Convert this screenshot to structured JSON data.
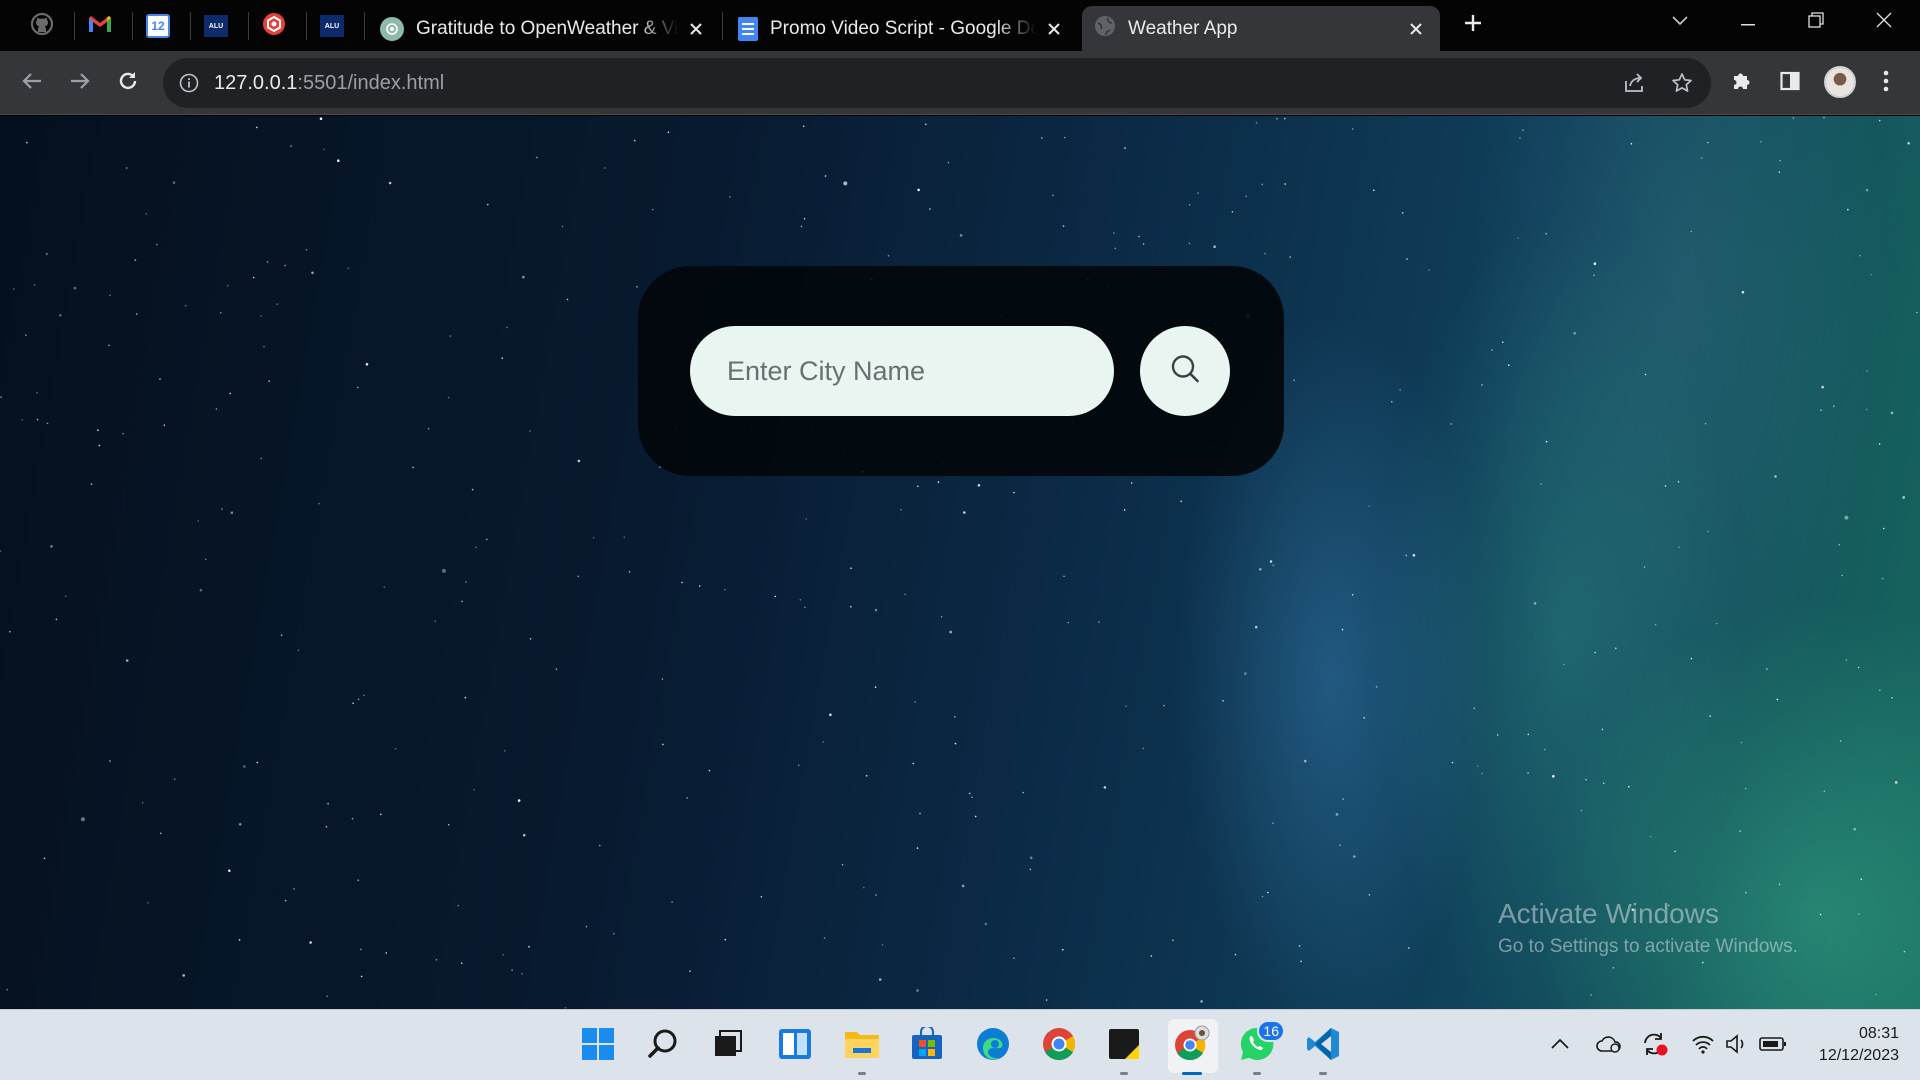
{
  "browser": {
    "tabs": [
      {
        "title": "Gratitude to OpenWeather & Vis",
        "icon": "chatgpt-icon"
      },
      {
        "title": "Promo Video Script - Google Do",
        "icon": "google-docs-icon"
      },
      {
        "title": "Weather App",
        "icon": "globe-icon",
        "active": true
      }
    ],
    "pinned_tabs": [
      "github-icon",
      "gmail-icon",
      "google-calendar-icon",
      "alu-icon",
      "bookmark-app-icon",
      "alu-icon"
    ],
    "calendar_day": "12",
    "pinned_label": "ALU",
    "url_host": "127.0.0.1",
    "url_path": ":5501/index.html"
  },
  "page": {
    "search_placeholder": "Enter City Name",
    "search_value": ""
  },
  "watermark": {
    "title": "Activate Windows",
    "subtitle": "Go to Settings to activate Windows."
  },
  "taskbar": {
    "apps": [
      "start",
      "search",
      "task-view",
      "widgets",
      "file-explorer",
      "microsoft-store",
      "edge",
      "chrome",
      "sticky-notes",
      "chrome-active",
      "whatsapp",
      "vscode"
    ],
    "whatsapp_badge": "16",
    "time": "08:31",
    "date": "12/12/2023"
  },
  "colors": {
    "accent": "#0067c0",
    "input_bg": "#e8f5f1",
    "card_bg": "#02080c",
    "tab_active": "#35363a"
  }
}
